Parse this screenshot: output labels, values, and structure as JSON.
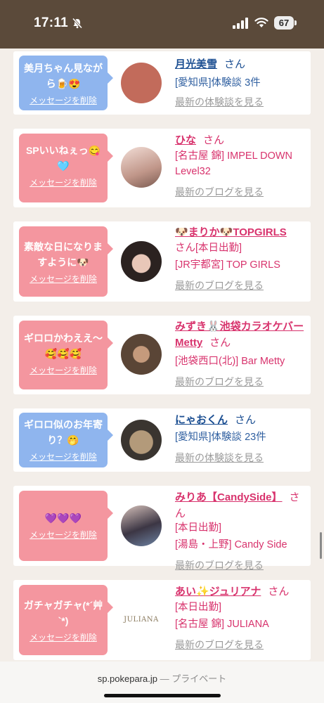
{
  "status_bar": {
    "time": "17:11",
    "battery": "67"
  },
  "cards": [
    {
      "bubble_color": "blue",
      "message": "美月ちゃん見ながら🍺😍",
      "delete_label": "メッセージを削除",
      "avatar": "bear-cookie-photo",
      "name": "月光美雪",
      "san": "さん",
      "details": [
        "[愛知県]体験談 3件"
      ],
      "link": "最新の体験談を見る",
      "name_color": "blue"
    },
    {
      "bubble_color": "pink",
      "message": "SPいいねぇっ😋🩵",
      "delete_label": "メッセージを削除",
      "avatar": "girl-photo",
      "name": "ひな",
      "san": "さん",
      "details": [
        "[名古屋 錦] IMPEL DOWN",
        "Level32"
      ],
      "link": "最新のブログを見る",
      "name_color": "pink"
    },
    {
      "bubble_color": "pink",
      "message": "素敵な日になりますように🐶",
      "delete_label": "メッセージを削除",
      "avatar": "girl-photo",
      "name": "🐶まりか🐶TOPGIRLS",
      "san": "さん",
      "details": [
        "[本日出勤]",
        "[JR宇都宮] TOP GIRLS"
      ],
      "link": "最新のブログを見る",
      "name_color": "pink"
    },
    {
      "bubble_color": "pink",
      "message": "ギロロかわええ〜🥰🥰🥰",
      "delete_label": "メッセージを削除",
      "avatar": "girl-photo",
      "name": "みずき🐰池袋カラオケバーMetty",
      "san": "さん",
      "details": [
        "[池袋西口(北)] Bar Metty"
      ],
      "link": "最新のブログを見る",
      "name_color": "pink"
    },
    {
      "bubble_color": "blue",
      "message": "ギロロ似のお年寄り？🤭",
      "delete_label": "メッセージを削除",
      "avatar": "cat-photo",
      "name": "にゃおくん",
      "san": "さん",
      "details": [
        "[愛知県]体験談 23件"
      ],
      "link": "最新の体験談を見る",
      "name_color": "blue"
    },
    {
      "bubble_color": "pink",
      "message": "💜💜💜",
      "delete_label": "メッセージを削除",
      "avatar": "girl-photo",
      "name": "みりあ【CandySide】",
      "san": "さん",
      "details": [
        "[本日出勤]",
        "[湯島・上野] Candy Side"
      ],
      "link": "最新のブログを見る",
      "name_color": "pink"
    },
    {
      "bubble_color": "pink",
      "message": "ガチャガチャ(*´艸`*)",
      "delete_label": "メッセージを削除",
      "avatar": "juliana-logo",
      "avatar_text": "JULIANA",
      "name": "あい✨ジュリアナ",
      "san": "さん",
      "details": [
        "[本日出勤]",
        "[名古屋 錦] JULIANA"
      ],
      "link": "最新のブログを見る",
      "name_color": "pink"
    }
  ],
  "url_bar": {
    "domain": "sp.pokepara.jp",
    "separator": "—",
    "mode": "プライベート"
  }
}
